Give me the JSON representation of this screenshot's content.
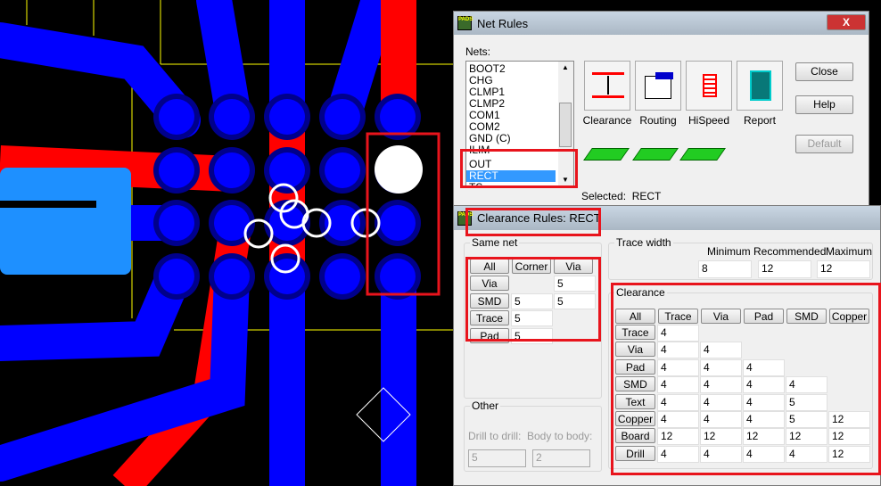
{
  "net_rules": {
    "title": "Net Rules",
    "close_x": "X",
    "nets_label": "Nets:",
    "nets": [
      "BOOT2",
      "CHG",
      "CLMP1",
      "CLMP2",
      "COM1",
      "COM2",
      "GND  (C)",
      "ILIM",
      "OUT",
      "RECT",
      "TS"
    ],
    "selected_net": "RECT",
    "selected_label": "Selected:",
    "icon_buttons": [
      {
        "label": "Clearance",
        "icon": "clearance-icon"
      },
      {
        "label": "Routing",
        "icon": "routing-icon"
      },
      {
        "label": "HiSpeed",
        "icon": "hispeed-icon"
      },
      {
        "label": "Report",
        "icon": "report-icon"
      }
    ],
    "close": "Close",
    "help": "Help",
    "default": "Default"
  },
  "clearance_rules": {
    "title": "Clearance Rules:  RECT",
    "same_net": {
      "label": "Same net",
      "headers": [
        "All",
        "Corner",
        "Via"
      ],
      "rows": [
        {
          "label": "Via",
          "values": [
            "",
            "5"
          ]
        },
        {
          "label": "SMD",
          "values": [
            "5",
            "5"
          ]
        },
        {
          "label": "Trace",
          "values": [
            "5",
            ""
          ]
        },
        {
          "label": "Pad",
          "values": [
            "5",
            ""
          ]
        }
      ]
    },
    "trace_width": {
      "label": "Trace width",
      "minimum_label": "Minimum",
      "recommended_label": "Recommended",
      "maximum_label": "Maximum",
      "minimum": "8",
      "recommended": "12",
      "maximum": "12"
    },
    "clearance": {
      "label": "Clearance",
      "headers": [
        "All",
        "Trace",
        "Via",
        "Pad",
        "SMD",
        "Copper"
      ],
      "rows": [
        {
          "label": "Trace",
          "values": [
            "4"
          ]
        },
        {
          "label": "Via",
          "values": [
            "4",
            "4"
          ]
        },
        {
          "label": "Pad",
          "values": [
            "4",
            "4",
            "4"
          ]
        },
        {
          "label": "SMD",
          "values": [
            "4",
            "4",
            "4",
            "4"
          ]
        },
        {
          "label": "Text",
          "values": [
            "4",
            "4",
            "4",
            "5"
          ]
        },
        {
          "label": "Copper",
          "values": [
            "4",
            "4",
            "4",
            "5",
            "12"
          ]
        },
        {
          "label": "Board",
          "values": [
            "12",
            "12",
            "12",
            "12",
            "12"
          ]
        },
        {
          "label": "Drill",
          "values": [
            "4",
            "4",
            "4",
            "4",
            "12"
          ]
        }
      ]
    },
    "other": {
      "label": "Other",
      "drill_to_drill_label": "Drill to drill:",
      "body_to_body_label": "Body to body:",
      "drill_to_drill": "5",
      "body_to_body": "2"
    }
  },
  "colors": {
    "highlight": "#e8141c",
    "top_layer": "#0000ff",
    "bottom_layer": "#ff0000",
    "selection": "#3399ff"
  }
}
